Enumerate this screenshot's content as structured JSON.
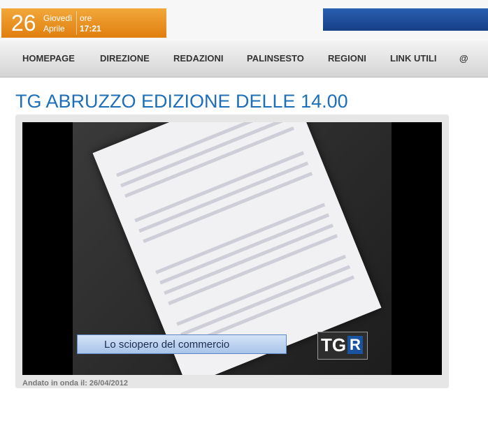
{
  "header": {
    "day_number": "26",
    "day_name": "Giovedì",
    "month": "Aprile",
    "ore_label": "ore",
    "time": "17:21"
  },
  "nav": {
    "items": [
      "HOMEPAGE",
      "DIREZIONE",
      "REDAZIONI",
      "PALINSESTO",
      "REGIONI",
      "LINK UTILI",
      "@"
    ]
  },
  "page": {
    "title": "TG ABRUZZO EDIZIONE DELLE 14.00"
  },
  "video": {
    "caption": "Lo sciopero del commercio",
    "logo_tg": "TG",
    "logo_r": "R"
  },
  "meta": {
    "aired": "Andato in onda il: 26/04/2012"
  }
}
